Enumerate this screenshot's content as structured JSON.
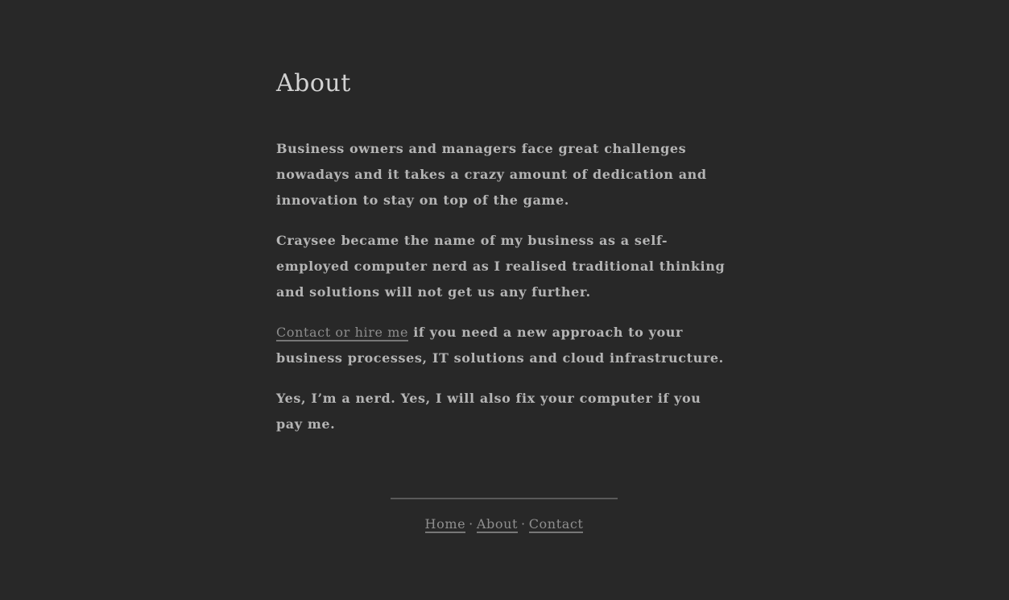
{
  "page": {
    "title": "About"
  },
  "content": {
    "paragraph_1": "Business owners and managers face great challenges nowadays and it takes a crazy amount of dedication and innovation to stay on top of the game.",
    "paragraph_2": "Craysee became the name of my business as a self-employed computer nerd as I realised traditional thinking and solutions will not get us any further.",
    "paragraph_3_link": "Contact or hire me",
    "paragraph_3_rest": " if you need a new approach to your business processes, IT solutions and cloud infrastructure.",
    "paragraph_4": "Yes, I’m a nerd. Yes, I will also fix your computer if you pay me."
  },
  "footer": {
    "nav": {
      "home": "Home",
      "about": "About",
      "contact": "Contact",
      "separator": "·"
    }
  },
  "colors": {
    "background": "#282828",
    "text": "#b4b4b4",
    "title": "#d2d2d2",
    "link": "#8f8f8f"
  }
}
